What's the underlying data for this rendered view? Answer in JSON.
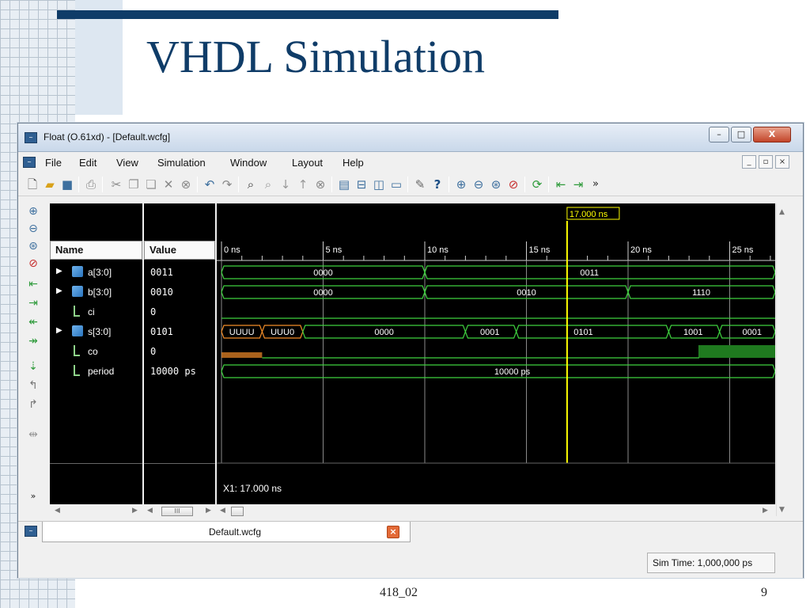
{
  "slide": {
    "title": "VHDL Simulation",
    "footer_left": "418_02",
    "page_number": "9"
  },
  "window": {
    "title": "Float (O.61xd) - [Default.wcfg]",
    "icon": "waveform-icon"
  },
  "menu": {
    "items": [
      "File",
      "Edit",
      "View",
      "Simulation",
      "Window",
      "Layout",
      "Help"
    ]
  },
  "toolbar": {
    "icons": [
      "new-icon",
      "open-icon",
      "save-icon",
      "print-icon",
      "cut-icon",
      "copy-icon",
      "paste-icon",
      "delete-icon",
      "cancel-icon",
      "undo-icon",
      "redo-icon",
      "find-icon",
      "find-next-icon",
      "down-icon",
      "up-icon",
      "stop-icon",
      "tile-icon",
      "split-h-icon",
      "split-v-icon",
      "cascade-icon",
      "wrench-icon",
      "whats-this-icon",
      "zoom-in-icon",
      "zoom-out-icon",
      "zoom-fit-icon",
      "zoom-cursor-icon",
      "refresh-icon",
      "marker-prev-icon",
      "marker-next-icon"
    ],
    "more": "»"
  },
  "side_toolbar": {
    "icons": [
      "zoom-in-icon",
      "zoom-out-icon",
      "zoom-fit-icon",
      "zoom-cursor-icon",
      "go-start-icon",
      "go-end-icon",
      "prev-transition-icon",
      "next-transition-icon",
      "add-marker-icon",
      "prev-marker-icon",
      "next-marker-icon",
      "swap-cursors-icon"
    ],
    "more": "»"
  },
  "panes": {
    "name_header": "Name",
    "value_header": "Value"
  },
  "signals": [
    {
      "name": "a[3:0]",
      "value": "0011",
      "kind": "bus",
      "expandable": true
    },
    {
      "name": "b[3:0]",
      "value": "0010",
      "kind": "bus",
      "expandable": true
    },
    {
      "name": "ci",
      "value": "0",
      "kind": "bit",
      "expandable": false
    },
    {
      "name": "s[3:0]",
      "value": "0101",
      "kind": "bus",
      "expandable": true
    },
    {
      "name": "co",
      "value": "0",
      "kind": "bit",
      "expandable": false
    },
    {
      "name": "period",
      "value": "10000 ps",
      "kind": "param",
      "expandable": false
    }
  ],
  "waveform": {
    "time_ticks": [
      "0 ns",
      "5 ns",
      "10 ns",
      "15 ns",
      "20 ns",
      "25 ns"
    ],
    "cursor_label": "17.000 ns",
    "cursor_readout": "X1: 17.000 ns",
    "rows": {
      "a": [
        [
          "0000",
          0,
          10
        ],
        [
          "0011",
          10,
          28
        ]
      ],
      "b": [
        [
          "0000",
          0,
          10
        ],
        [
          "0010",
          10,
          20
        ],
        [
          "1110",
          20,
          28
        ]
      ],
      "s": [
        [
          "UUUU",
          0,
          2
        ],
        [
          "UUU0",
          2,
          4
        ],
        [
          "0000",
          4,
          12
        ],
        [
          "0001",
          12,
          14.5
        ],
        [
          "0101",
          14.5,
          22
        ],
        [
          "1001",
          22,
          24.5
        ],
        [
          "0001",
          24.5,
          28
        ]
      ],
      "s_labels": [
        [
          "UUUU",
          1
        ],
        [
          "UUU0",
          3
        ],
        [
          "0000",
          8
        ],
        [
          "0001",
          13.2
        ],
        [
          "0101",
          17.8
        ],
        [
          "1001",
          23.2
        ],
        [
          "0001",
          26.1
        ]
      ],
      "a_labels": [
        [
          "0000",
          5
        ],
        [
          "0011",
          18.1
        ]
      ],
      "b_labels": [
        [
          "0000",
          5
        ],
        [
          "0010",
          15
        ],
        [
          "1110",
          23.6
        ]
      ],
      "period_label": "10000 ps"
    },
    "colors": {
      "trace": "#3fd13f",
      "undefined": "#f28c28",
      "cursor": "#ffff00",
      "grid": "#8a8a8a"
    }
  },
  "tabs": {
    "document": "Default.wcfg"
  },
  "status": {
    "sim_time": "Sim Time: 1,000,000 ps"
  }
}
